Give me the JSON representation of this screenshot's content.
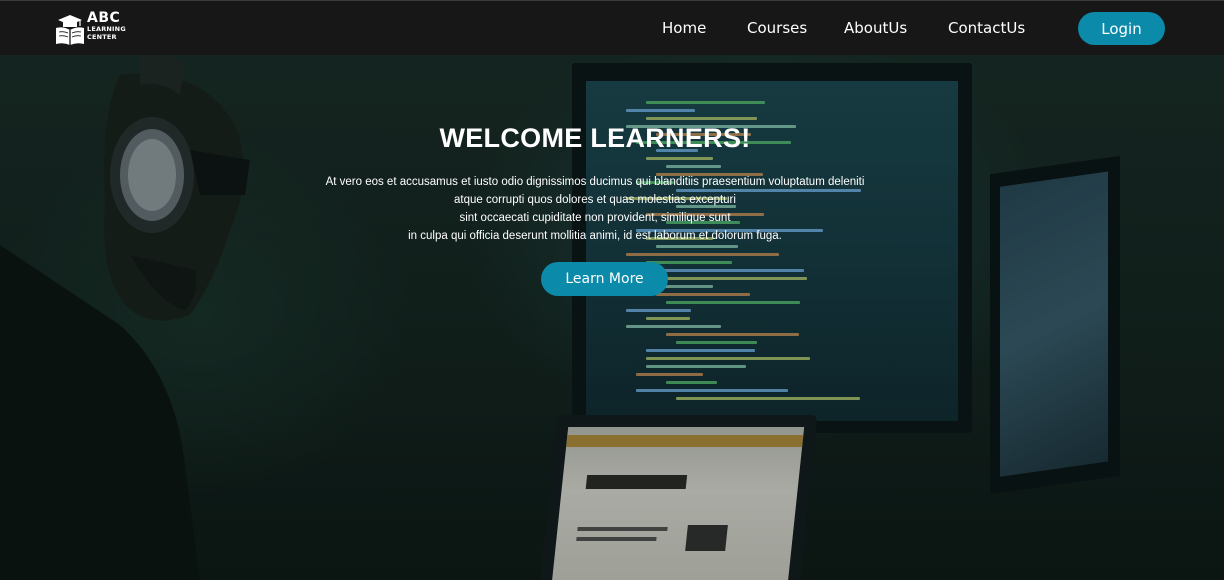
{
  "logo": {
    "title": "ABC",
    "subtitle": "LEARNING CENTER"
  },
  "nav": {
    "items": [
      "Home",
      "Courses",
      "AboutUs",
      "ContactUs"
    ],
    "login_label": "Login"
  },
  "hero": {
    "title": "WELCOME LEARNERS!",
    "lines": [
      "At vero eos et accusamus et iusto odio dignissimos ducimus qui blanditiis praesentium voluptatum deleniti",
      "atque corrupti quos dolores et quas molestias excepturi",
      "sint occaecati cupiditate non provident, similique sunt",
      "in culpa qui officia deserunt mollitia animi, id est laborum et dolorum fuga."
    ],
    "button_label": "Learn More"
  },
  "colors": {
    "accent": "#0b8aa9",
    "navbar": "#171717",
    "hero_text": "#ffffff"
  },
  "icons": {
    "logo": "open-book-graduation-cap-icon"
  }
}
